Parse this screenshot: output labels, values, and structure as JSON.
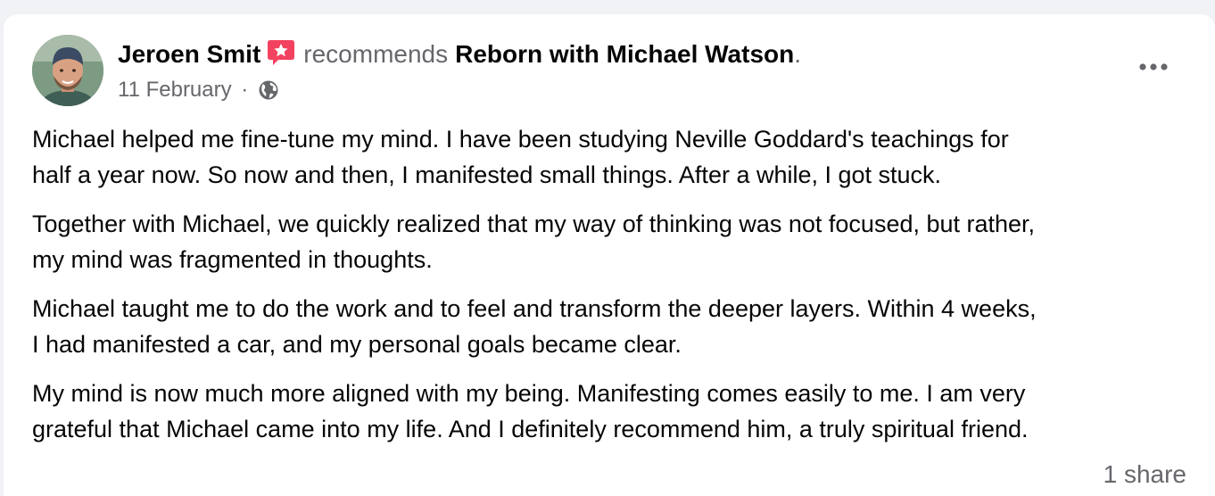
{
  "post": {
    "author": "Jeroen Smit",
    "action": "recommends",
    "page": "Reborn with Michael Watson",
    "trailing_punct": ".",
    "date": "11 February",
    "separator": "·",
    "audience_icon": "globe-icon",
    "recommend_icon": "recommend-star-icon",
    "more_icon": "more-options-icon",
    "paragraphs": [
      "Michael helped me fine-tune my mind. I have been studying Neville Goddard's teachings for\nhalf a year now. So now and then, I manifested small things. After a while, I got stuck.",
      "Together with Michael, we quickly realized that my way of thinking was not focused, but rather,\nmy mind was fragmented in thoughts.",
      "Michael taught me to do the work and to feel and transform the deeper layers. Within 4 weeks,\nI had manifested a car, and my personal goals became clear.",
      "My mind is now much more aligned with my being. Manifesting comes easily to me. I am very\ngrateful that Michael came into my life. And I definitely recommend him, a truly spiritual friend."
    ],
    "share_count": "1 share"
  },
  "colors": {
    "background": "#f0f2f5",
    "card": "#ffffff",
    "text_primary": "#050505",
    "text_secondary": "#65676b",
    "recommend_accent": "#f3425f"
  }
}
